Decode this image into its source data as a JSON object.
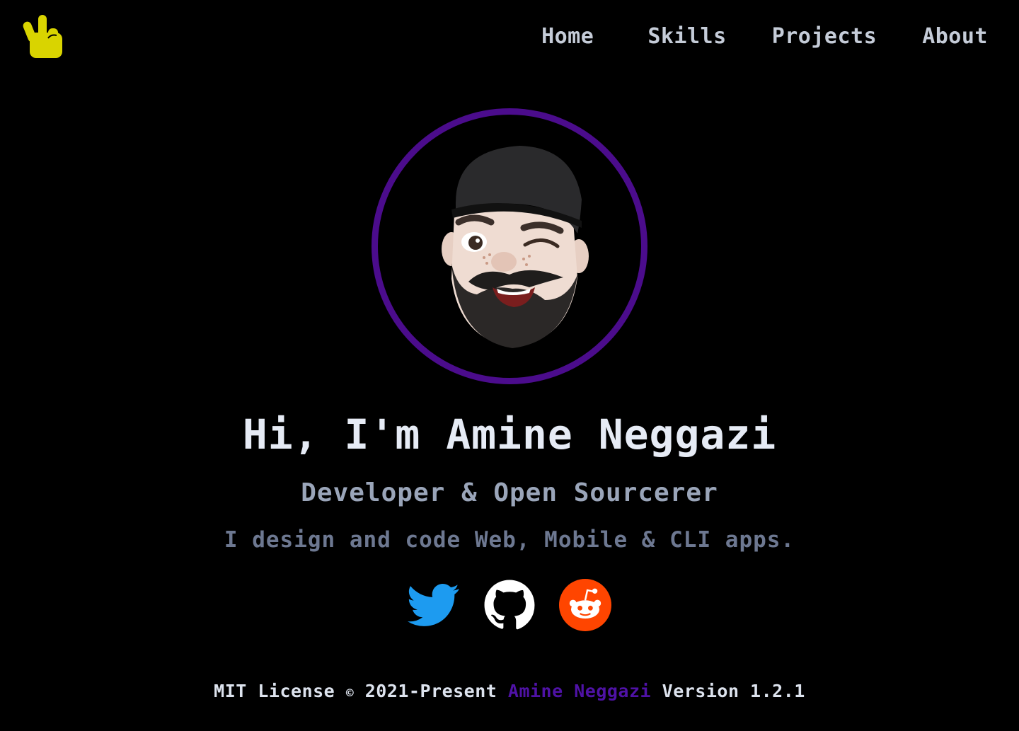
{
  "nav": {
    "logo_icon": "peace-hand-icon",
    "items": [
      {
        "label": "Home"
      },
      {
        "label": "Skills"
      },
      {
        "label": "Projects"
      },
      {
        "label": "About"
      }
    ]
  },
  "hero": {
    "avatar_icon": "memoji-avatar",
    "title": "Hi, I'm Amine Neggazi",
    "subtitle": "Developer & Open Sourcerer",
    "tagline": "I design and code Web, Mobile & CLI apps."
  },
  "socials": [
    {
      "name": "Twitter",
      "icon": "twitter-icon",
      "color": "#1d9bf0"
    },
    {
      "name": "GitHub",
      "icon": "github-icon",
      "color": "#ffffff"
    },
    {
      "name": "Reddit",
      "icon": "reddit-icon",
      "color": "#ff4500"
    }
  ],
  "footer": {
    "license": "MIT License",
    "copyright_symbol": "©",
    "years": "2021-Present",
    "author": "Amine Neggazi",
    "version": "Version 1.2.1"
  },
  "colors": {
    "background": "#000000",
    "accent": "#4b0c8c",
    "logo": "#d9d400",
    "nav_text": "#c5ccd8"
  }
}
